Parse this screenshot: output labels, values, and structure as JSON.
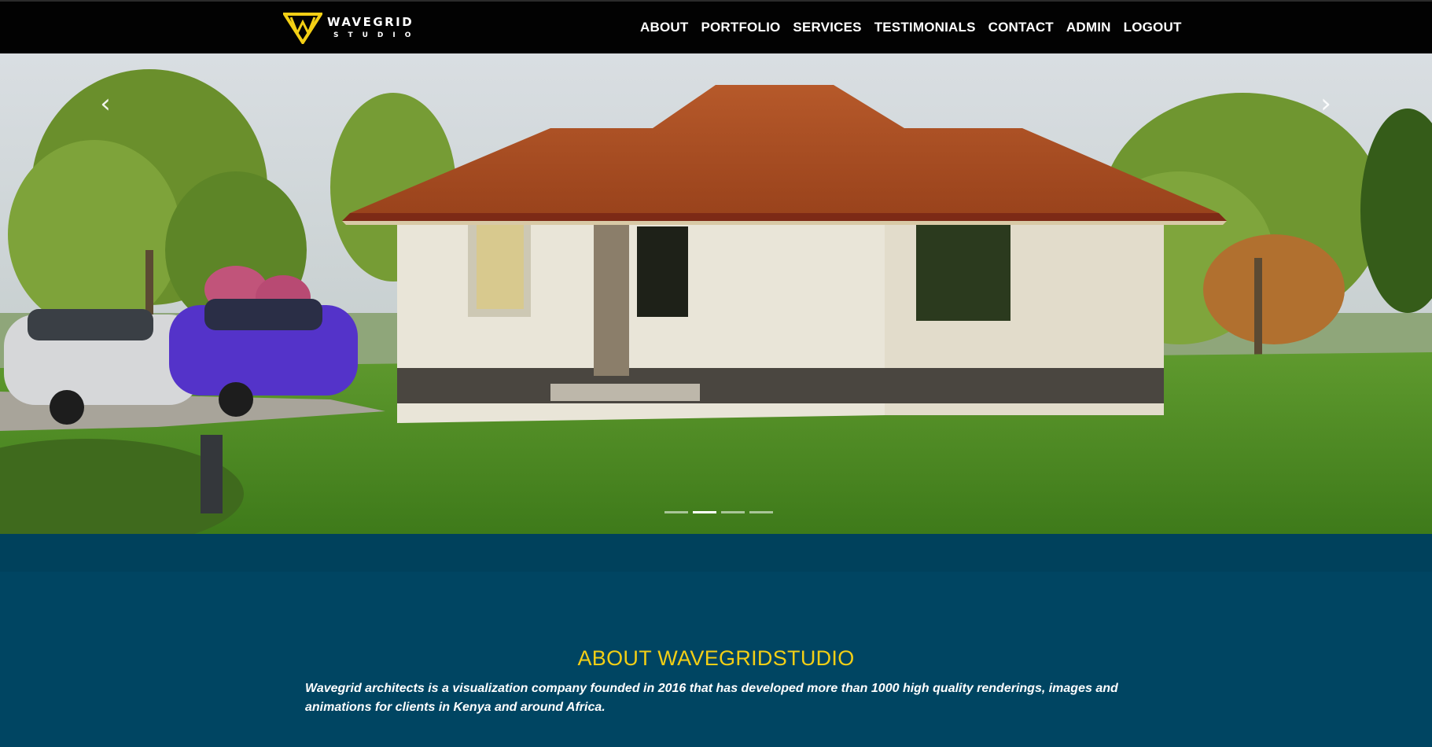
{
  "brand": {
    "name": "WAVEGRID",
    "sub": "STUDIO",
    "logo_icon": "wg-triangle-logo-icon",
    "accent_color": "#f3cf15"
  },
  "nav": {
    "items": [
      "ABOUT",
      "PORTFOLIO",
      "SERVICES",
      "TESTIMONIALS",
      "CONTACT",
      "ADMIN",
      "LOGOUT"
    ]
  },
  "carousel": {
    "prev_icon": "chevron-left-icon",
    "next_icon": "chevron-right-icon",
    "prev_glyph": "‹",
    "next_glyph": "›",
    "slide_count": 4,
    "active_index": 1
  },
  "about": {
    "title": "ABOUT WAVEGRIDSTUDIO",
    "text": "Wavegrid architects is a visualization company founded in 2016 that has developed more than 1000 high quality renderings, images and animations for clients in Kenya and around Africa.",
    "background_color": "#004562"
  }
}
